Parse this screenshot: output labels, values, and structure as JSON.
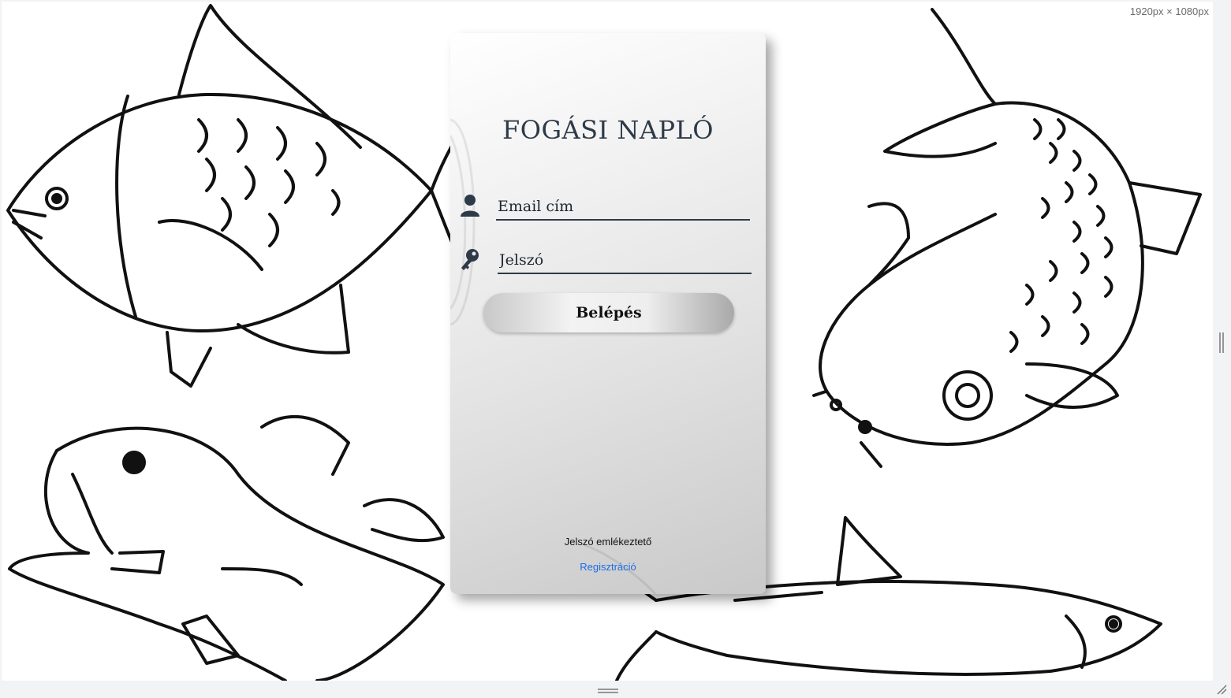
{
  "viewport": {
    "size_label": "1920px × 1080px"
  },
  "login": {
    "title": "FOGÁSI NAPLÓ",
    "email_placeholder": "Email cím",
    "password_placeholder": "Jelszó",
    "login_button": "Belépés",
    "remember_link": "Jelszó emlékeztető",
    "register_link": "Regisztráció"
  },
  "icons": {
    "email": "user-icon",
    "password": "key-icon"
  },
  "colors": {
    "title": "#2e3a48",
    "link": "#1a6ee8"
  }
}
